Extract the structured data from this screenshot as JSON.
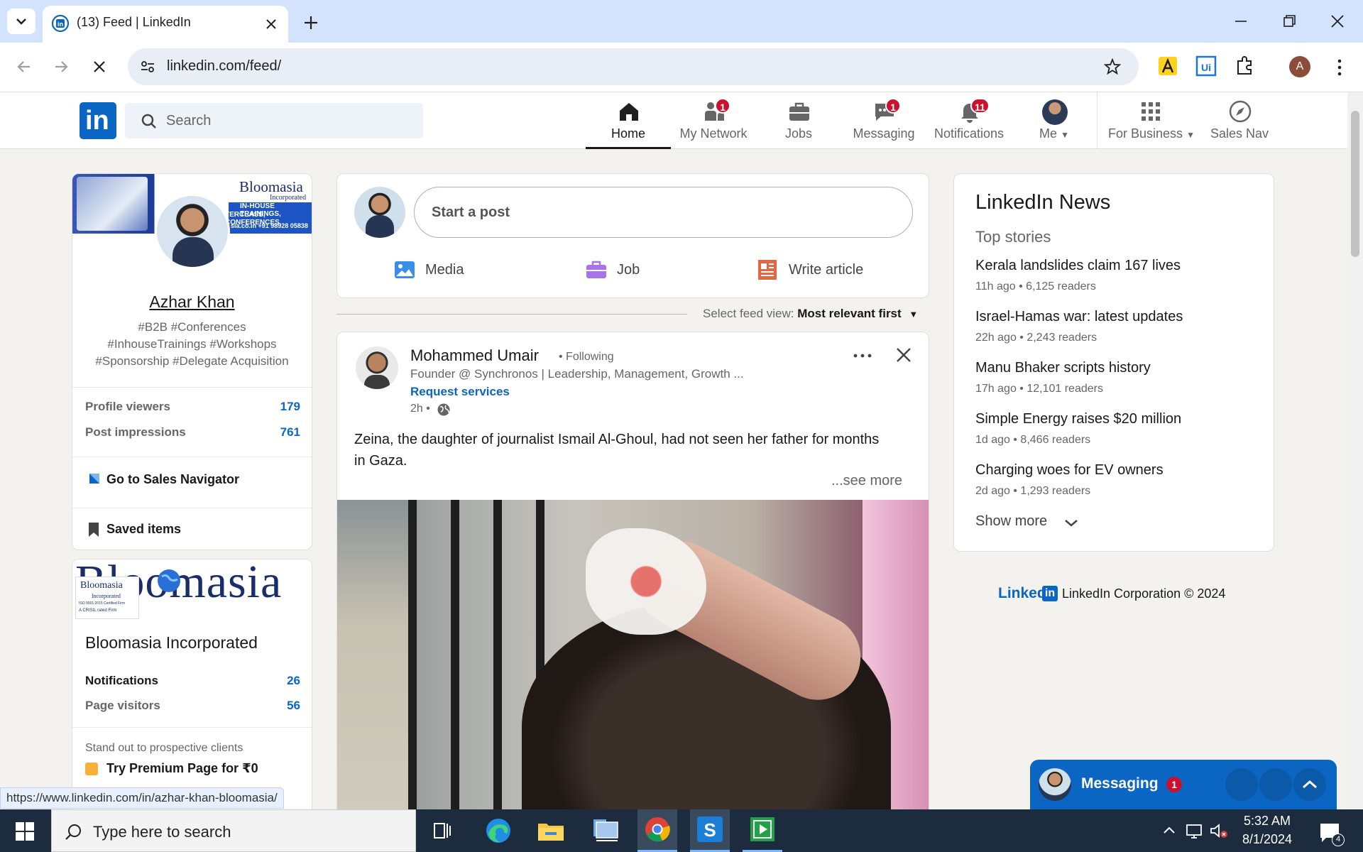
{
  "browser": {
    "tab_title": "(13) Feed | LinkedIn",
    "url": "linkedin.com/feed/",
    "profile_initial": "A"
  },
  "nav": {
    "search_placeholder": "Search",
    "items": [
      {
        "label": "Home",
        "badge": ""
      },
      {
        "label": "My Network",
        "badge": "1"
      },
      {
        "label": "Jobs",
        "badge": ""
      },
      {
        "label": "Messaging",
        "badge": "1"
      },
      {
        "label": "Notifications",
        "badge": "11"
      },
      {
        "label": "Me",
        "badge": ""
      },
      {
        "label": "For Business",
        "badge": ""
      },
      {
        "label": "Sales Nav",
        "badge": ""
      }
    ]
  },
  "profile": {
    "banner_brand": "Bloomasia",
    "banner_brand_sub": "Incorporated",
    "banner_line1": "IN-HOUSE TRAININGS,",
    "banner_line2": "TERCLASS, CONFERENCES.",
    "banner_contact": "sia.co.in  +91 98928 05838",
    "name": "Azhar Khan",
    "headline1": "#B2B #Conferences",
    "headline2": "#InhouseTrainings #Workshops",
    "headline3": "#Sponsorship #Delegate Acquisition",
    "stats": [
      {
        "label": "Profile viewers",
        "value": "179"
      },
      {
        "label": "Post impressions",
        "value": "761"
      }
    ],
    "sales_nav": "Go to Sales Navigator",
    "saved": "Saved items"
  },
  "company": {
    "logo_text": "Bloomasia",
    "logo_small": "Bloomasia",
    "logo_small_sub": "Incorporated",
    "logo_small_line": "ISO 9001:2015 Certified Firm",
    "logo_small_line2": "A CRISIL rated Firm",
    "name": "Bloomasia Incorporated",
    "stats": [
      {
        "label": "Notifications",
        "value": "26"
      },
      {
        "label": "Page visitors",
        "value": "56"
      }
    ],
    "promo": "Stand out to prospective clients",
    "premium": "Try Premium Page for ₹0"
  },
  "composer": {
    "placeholder": "Start a post",
    "media": "Media",
    "job": "Job",
    "article": "Write article"
  },
  "feed_sort": {
    "label": "Select feed view:",
    "value": "Most relevant first"
  },
  "post": {
    "author": "Mohammed Umair",
    "following": "• Following",
    "headline": "Founder @ Synchronos | Leadership, Management, Growth ...",
    "request": "Request services",
    "time": "2h •",
    "text": "Zeina, the daughter of journalist Ismail Al-Ghoul, had not seen her father for months in Gaza.",
    "see_more": "...see more"
  },
  "news": {
    "title": "LinkedIn News",
    "subtitle": "Top stories",
    "items": [
      {
        "headline": "Kerala landslides claim 167 lives",
        "meta": "11h ago • 6,125 readers"
      },
      {
        "headline": "Israel-Hamas war: latest updates",
        "meta": "22h ago • 2,243 readers"
      },
      {
        "headline": "Manu Bhaker scripts history",
        "meta": "17h ago • 12,101 readers"
      },
      {
        "headline": "Simple Energy raises $20 million",
        "meta": "1d ago • 8,466 readers"
      },
      {
        "headline": "Charging woes for EV owners",
        "meta": "2d ago • 1,293 readers"
      }
    ],
    "show_more": "Show more"
  },
  "footer": {
    "brand": "Linked",
    "copyright": "LinkedIn Corporation © 2024"
  },
  "messaging_bar": {
    "label": "Messaging",
    "badge": "1"
  },
  "status_url": "https://www.linkedin.com/in/azhar-khan-bloomasia/",
  "taskbar": {
    "search_placeholder": "Type here to search",
    "time": "5:32 AM",
    "date": "8/1/2024",
    "notification_count": "4"
  },
  "colors": {
    "linkedin_blue": "#0a66c2",
    "badge_red": "#cb112d",
    "tab_strip": "#d3e3fd",
    "taskbar": "#1c2b3d"
  }
}
